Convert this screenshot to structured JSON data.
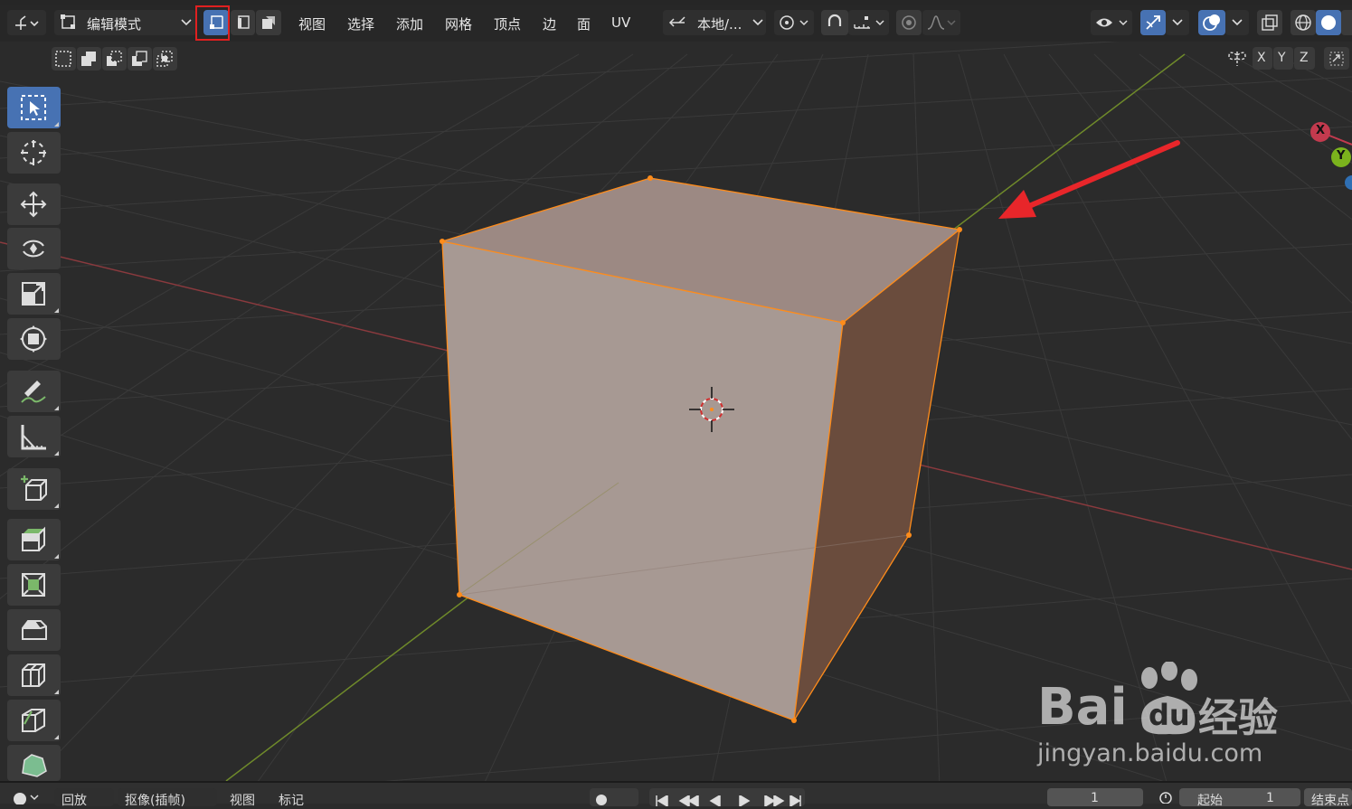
{
  "header": {
    "mode_label": "编辑模式",
    "menus": [
      "视图",
      "选择",
      "添加",
      "网格",
      "顶点",
      "边",
      "面",
      "UV"
    ],
    "transform_orientation": "本地/..."
  },
  "axes": {
    "x": "X",
    "y": "Y",
    "z": "Z"
  },
  "gizmo": {
    "x": "X",
    "y": "Y"
  },
  "bottom": {
    "items": [
      "回放",
      "抠像(插帧)",
      "视图",
      "标记"
    ],
    "frame_value": "1",
    "start_label": "起始",
    "start_value": "1",
    "end_label": "结束点"
  },
  "watermark": {
    "brand": "Bai",
    "brand2": "du",
    "cn": "经验",
    "url": "jingyan.baidu.com"
  },
  "colors": {
    "accent": "#4772b3",
    "highlight_box": "#e02020",
    "arrow": "#e8262a",
    "edge": "#ff8c1a"
  }
}
